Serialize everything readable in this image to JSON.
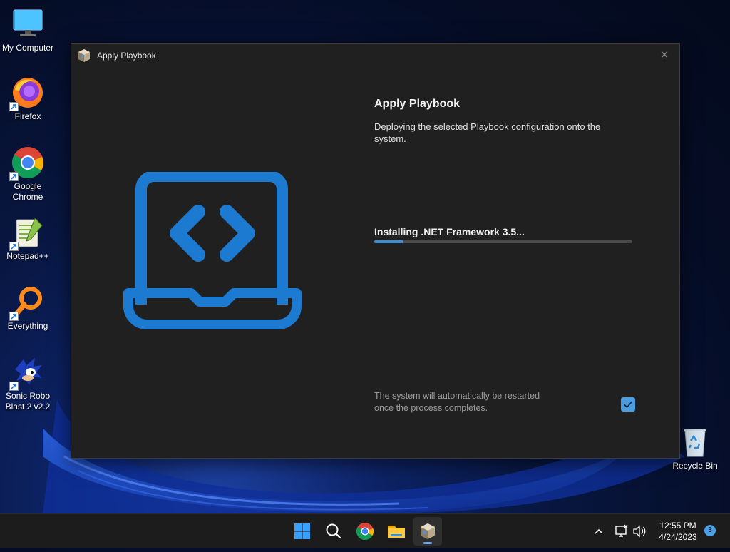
{
  "desktop": {
    "icons": [
      {
        "label": "My Computer"
      },
      {
        "label": "Firefox"
      },
      {
        "label": "Google Chrome"
      },
      {
        "label": "Notepad++"
      },
      {
        "label": "Everything"
      },
      {
        "label": "Sonic Robo Blast 2 v2.2"
      },
      {
        "label": "Recycle Bin"
      }
    ]
  },
  "window": {
    "title": "Apply Playbook",
    "heading": "Apply Playbook",
    "description": "Deploying the selected Playbook configuration onto the system.",
    "status": "Installing .NET Framework 3.5...",
    "progress": 0.11,
    "note": "The system will automatically be restarted once the process completes.",
    "restart_checked": true
  },
  "taskbar": {
    "time": "12:55 PM",
    "date": "4/24/2023",
    "notification_count": "3"
  },
  "colors": {
    "accent": "#3c8fd4",
    "window_bg": "#202020",
    "hero_icon": "#1d7ad1"
  }
}
